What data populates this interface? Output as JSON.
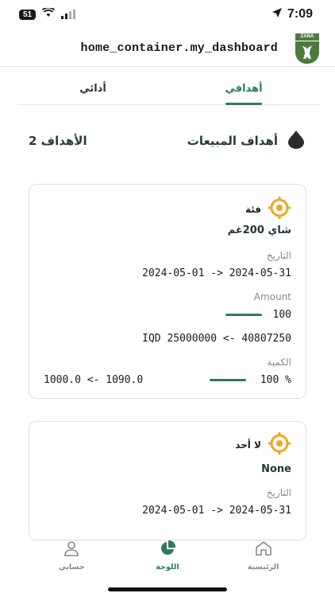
{
  "status": {
    "battery": "51",
    "time": "7:09"
  },
  "header": {
    "title": "home_container.my_dashboard",
    "logo_text": "ZANA"
  },
  "tabs": [
    {
      "label": "أهدافي",
      "active": true
    },
    {
      "label": "أدائي",
      "active": false
    }
  ],
  "section": {
    "title": "أهداف المبيعات",
    "count": "2 الأهداف"
  },
  "cards": [
    {
      "category": "فئة",
      "product": "شاي 200غم",
      "date_label": "التاريخ",
      "date_range": "2024-05-01 -> 2024-05-31",
      "amount_label": "Amount",
      "amount_value": "100",
      "iqd_range": "IQD 25000000 <- 40807250",
      "quantity_label": "الكمية",
      "quantity_percent": "100 %",
      "quantity_range": "1000.0 <- 1090.0"
    },
    {
      "category": "لا أحد",
      "product": "None",
      "date_label": "التاريخ",
      "date_range": "2024-05-01 -> 2024-05-31"
    }
  ],
  "bottom_nav": [
    {
      "label": "الرئيسية",
      "icon": "home-icon",
      "active": false
    },
    {
      "label": "اللوحة",
      "icon": "pie-chart-icon",
      "active": true
    },
    {
      "label": "حسابي",
      "icon": "person-icon",
      "active": false
    }
  ],
  "colors": {
    "accent": "#2f7a5d",
    "target_icon": "#f0a623",
    "logo_green": "#4e7a3d"
  }
}
